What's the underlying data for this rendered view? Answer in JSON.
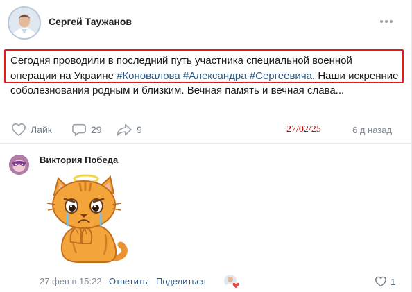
{
  "post": {
    "author": "Сергей Таужанов",
    "text_parts": {
      "intro": "Сегодня проводили в последний путь участника специальной военной операции на Украине ",
      "hashtag1": "#Коновалова",
      "hashtag2": "#Александра",
      "hashtag3": "#Сергеевича",
      "outro": ". Наши искренние соболезнования родным и близким. Вечная память и вечная слава..."
    },
    "actions": {
      "like_label": "Лайк",
      "comments_count": "29",
      "shares_count": "9"
    },
    "date_stamp": "27/02/25",
    "age": "6 д назад",
    "icons": [
      "avatar",
      "more-icon",
      "heart-icon",
      "comment-icon",
      "share-icon"
    ]
  },
  "comment": {
    "author": "Виктория Победа",
    "sticker": "crying-cat-with-halo-sticker",
    "date": "27 фев в 15:22",
    "reply_label": "Ответить",
    "share_label": "Поделиться",
    "like_count": "1",
    "icons": [
      "avatar",
      "liker-avatar",
      "heart-icon"
    ]
  },
  "colors": {
    "link": "#2a5885",
    "secondary": "#818c99",
    "highlight_border": "#e01b1b",
    "date_stamp": "#c00000",
    "like_heart": "#e64646"
  }
}
